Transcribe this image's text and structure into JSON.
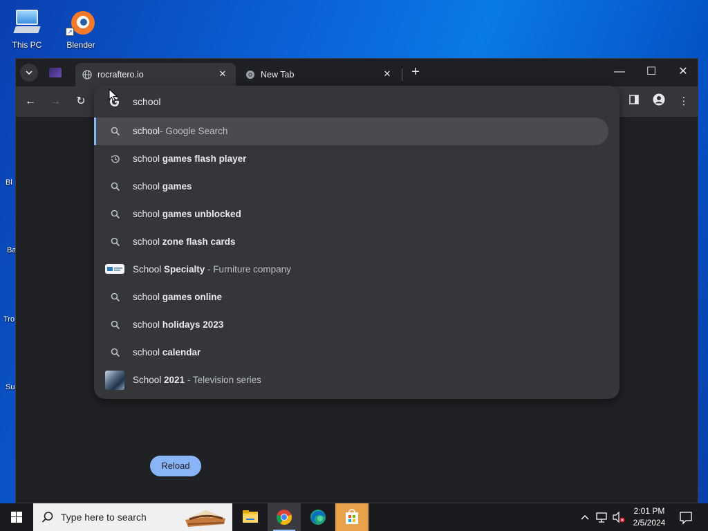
{
  "desktop": {
    "icons": [
      {
        "label": "This PC"
      },
      {
        "label": "Blender"
      }
    ],
    "side_fragments": [
      "Bl",
      "Ba",
      "Tro",
      "Su"
    ]
  },
  "browser": {
    "pinned_tab_icon": "purple-site-favicon",
    "tabs": [
      {
        "title": "rocraftero.io",
        "active": true
      },
      {
        "title": "New Tab",
        "active": false
      }
    ],
    "window_controls": {
      "minimize": "—",
      "maximize": "☐",
      "close": "✕"
    }
  },
  "omnibox": {
    "query": "school",
    "suggestions": [
      {
        "icon": "search-icon",
        "prefix": "school",
        "bold": "",
        "desc": "- Google Search",
        "selected": true
      },
      {
        "icon": "history-icon",
        "prefix": "school ",
        "bold": "games flash player",
        "desc": ""
      },
      {
        "icon": "search-icon",
        "prefix": "school ",
        "bold": "games",
        "desc": ""
      },
      {
        "icon": "search-icon",
        "prefix": "school ",
        "bold": "games unblocked",
        "desc": ""
      },
      {
        "icon": "search-icon",
        "prefix": "school ",
        "bold": "zone flash cards",
        "desc": ""
      },
      {
        "icon": "entity-thumbnail",
        "prefix": "School ",
        "bold": "Specialty",
        "desc": " - Furniture company"
      },
      {
        "icon": "search-icon",
        "prefix": "school ",
        "bold": "games online",
        "desc": ""
      },
      {
        "icon": "search-icon",
        "prefix": "school ",
        "bold": "holidays 2023",
        "desc": ""
      },
      {
        "icon": "search-icon",
        "prefix": "school ",
        "bold": "calendar",
        "desc": ""
      },
      {
        "icon": "entity-thumbnail",
        "prefix": "School ",
        "bold": "2021",
        "desc": " - Television series"
      }
    ]
  },
  "page": {
    "reload_label": "Reload"
  },
  "taskbar": {
    "search_placeholder": "Type here to search",
    "time": "2:01 PM",
    "date": "2/5/2024"
  }
}
